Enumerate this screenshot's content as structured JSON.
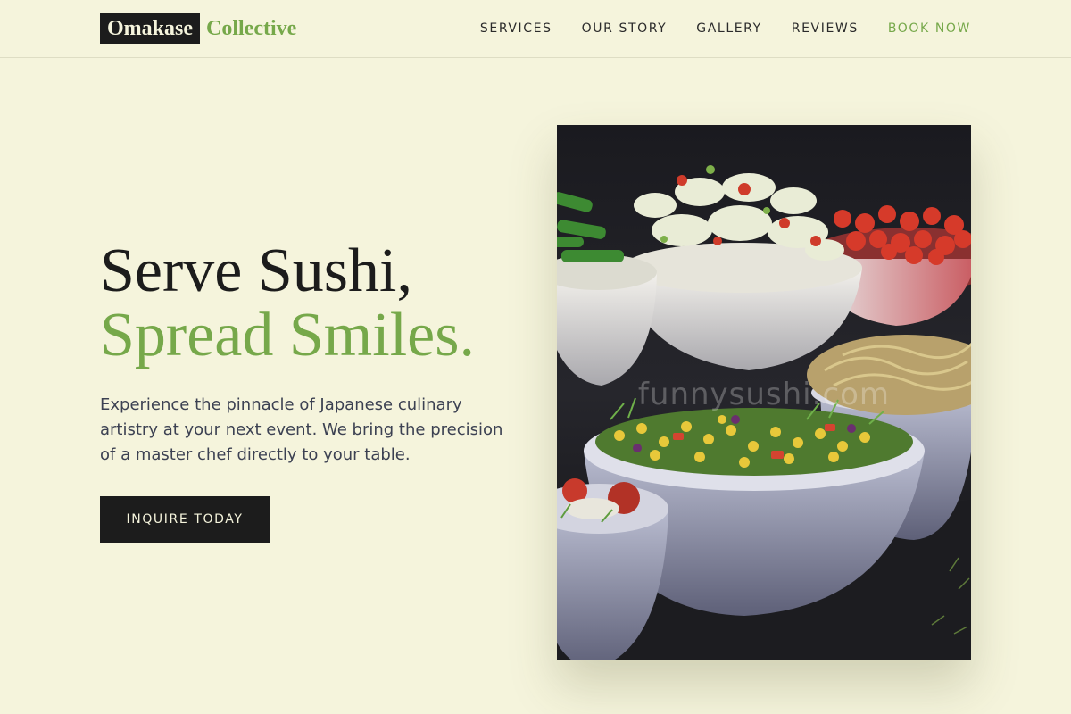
{
  "brand": {
    "name_primary": "Omakase",
    "name_accent": "Collective"
  },
  "nav": {
    "items": [
      "SERVICES",
      "OUR STORY",
      "GALLERY",
      "REVIEWS"
    ],
    "cta": "BOOK NOW"
  },
  "hero": {
    "headline_line1": "Serve Sushi,",
    "headline_line2": "Spread Smiles.",
    "description": "Experience the pinnacle of Japanese culinary artistry at your next event. We bring the precision of a master chef directly to your table.",
    "button_label": "INQUIRE TODAY",
    "image": {
      "subject": "bowls of salads on a buffet table",
      "watermark": "funnysushi.com"
    }
  },
  "colors": {
    "background": "#f5f4dc",
    "accent": "#76a84a",
    "dark": "#1c1c1c",
    "body_text": "#3c4152"
  }
}
